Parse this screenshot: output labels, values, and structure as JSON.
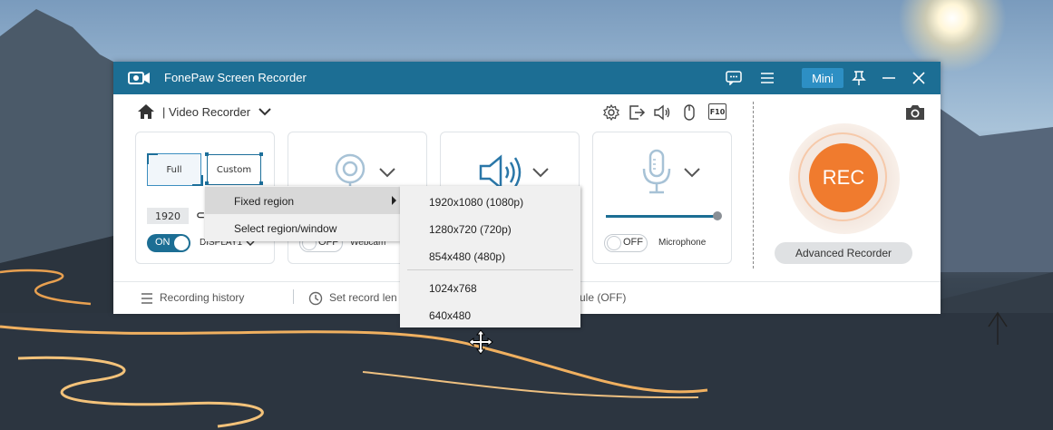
{
  "window": {
    "title": "FonePaw Screen Recorder",
    "mini_label": "Mini",
    "accent": "#1c6e94",
    "icons": [
      "app-logo-icon",
      "feedback-icon",
      "menu-icon",
      "pin-icon",
      "minimize-icon",
      "close-icon"
    ]
  },
  "header": {
    "mode_label": "| Video Recorder",
    "toolbar_icons": [
      "settings-icon",
      "export-icon",
      "speaker-icon",
      "mouse-icon",
      "hotkey-icon"
    ],
    "hotkey_label": "F10",
    "screenshot_icon": "camera-icon"
  },
  "display_panel": {
    "full_label": "Full",
    "custom_label": "Custom",
    "resolution_value": "1920",
    "resolution_cut": "⊂",
    "toggle_label": "ON",
    "source_label": "DISPLAY1"
  },
  "webcam_panel": {
    "toggle_label": "OFF",
    "label": "Webcam"
  },
  "system_sound_panel": {},
  "microphone_panel": {
    "toggle_label": "OFF",
    "label": "Microphone",
    "volume_fraction": 0.95
  },
  "rec": {
    "label": "REC",
    "color": "#f07b2e",
    "advanced_label": "Advanced Recorder"
  },
  "footer": {
    "recording_history": "Recording history",
    "set_record_length": "Set record len",
    "schedule": "ule (OFF)"
  },
  "context_menu": {
    "items": [
      {
        "label": "Fixed region",
        "has_submenu": true
      },
      {
        "label": "Select region/window",
        "has_submenu": false
      }
    ]
  },
  "submenu": {
    "items": [
      {
        "label": "1920x1080 (1080p)"
      },
      {
        "label": "1280x720 (720p)"
      },
      {
        "label": "854x480 (480p)"
      },
      {
        "label": "1024x768"
      },
      {
        "label": "640x480"
      }
    ]
  }
}
